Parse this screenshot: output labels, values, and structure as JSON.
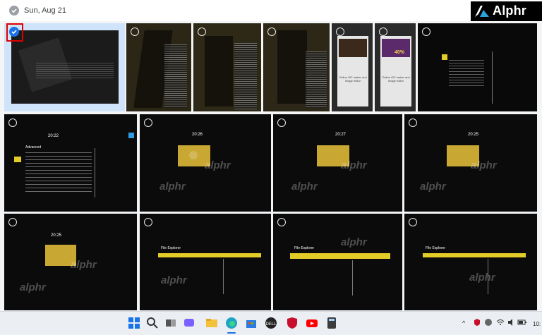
{
  "header": {
    "date": "Sun, Aug 21"
  },
  "logo": {
    "text": "Alphr"
  },
  "watermark": "alphr",
  "tiles": {
    "r2_clock": "20:22",
    "r2c2_clock": "20:26",
    "r2c3_clock": "20:27",
    "r2c4_clock": "20:25",
    "r3c1_clock": "20:25",
    "bios_title": "Advanced",
    "file_explorer": "File Explorer",
    "phone_caption": "Online GIF maker and image editor",
    "sale_badge": "40%"
  },
  "taskbar": {
    "icons": [
      "windows-start-icon",
      "search-icon",
      "file-explorer-folder-icon",
      "teams-chat-icon",
      "file-explorer-icon",
      "edge-icon",
      "microsoft-store-icon",
      "dell-icon",
      "mcafee-icon",
      "youtube-icon",
      "calculator-icon"
    ],
    "clock": "10:"
  },
  "colors": {
    "accent": "#1a73e8",
    "selection_box": "#e00000"
  }
}
